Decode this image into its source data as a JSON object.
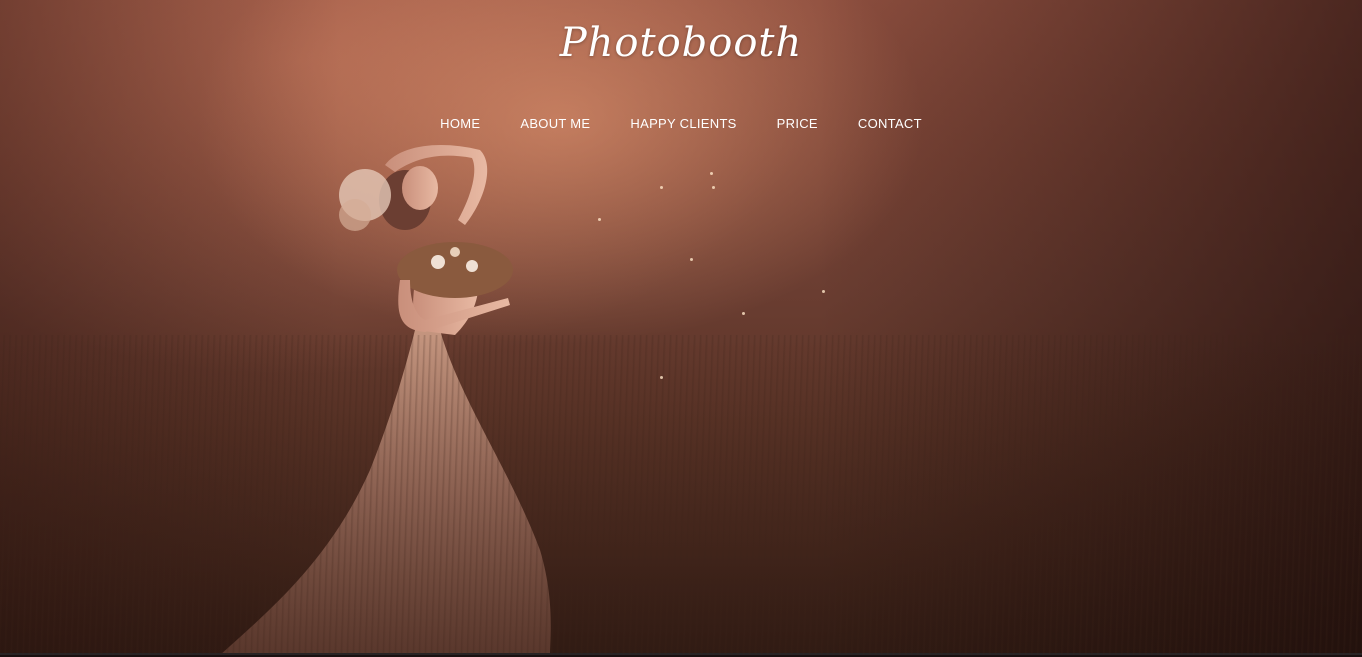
{
  "site": {
    "brand": "Photobooth"
  },
  "nav": {
    "items": [
      {
        "label": "HOME"
      },
      {
        "label": "ABOUT ME"
      },
      {
        "label": "HAPPY CLIENTS"
      },
      {
        "label": "PRICE"
      },
      {
        "label": "CONTACT"
      }
    ]
  },
  "hero": {
    "image": "hero-photo-woman-in-field",
    "accent_color": "#8e4f3f"
  }
}
